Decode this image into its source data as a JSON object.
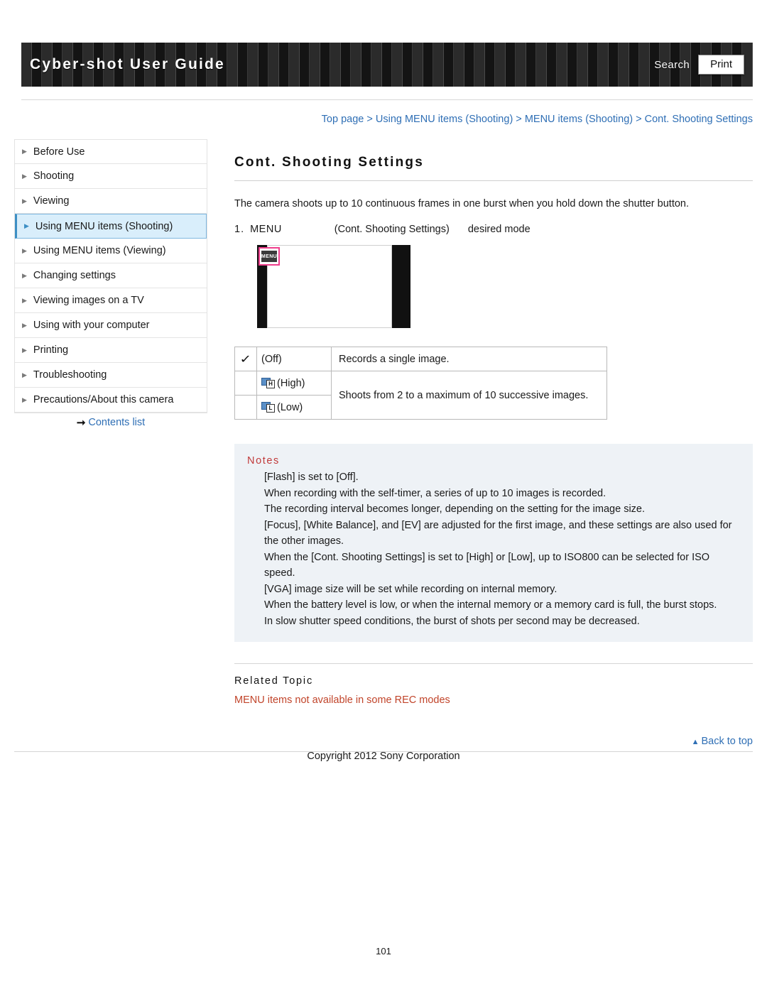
{
  "header": {
    "title": "Cyber-shot User Guide",
    "search_label": "Search",
    "print_label": "Print"
  },
  "breadcrumb": {
    "items": [
      "Top page",
      "Using MENU items (Shooting)",
      "MENU items (Shooting)",
      "Cont. Shooting Settings"
    ],
    "text": "Top page > Using MENU items (Shooting) > MENU items (Shooting) > Cont. Shooting Settings"
  },
  "sidebar": {
    "items": [
      {
        "label": "Before Use",
        "active": false
      },
      {
        "label": "Shooting",
        "active": false
      },
      {
        "label": "Viewing",
        "active": false
      },
      {
        "label": "Using MENU items (Shooting)",
        "active": true
      },
      {
        "label": "Using MENU items (Viewing)",
        "active": false
      },
      {
        "label": "Changing settings",
        "active": false
      },
      {
        "label": "Viewing images on a TV",
        "active": false
      },
      {
        "label": "Using with your computer",
        "active": false
      },
      {
        "label": "Printing",
        "active": false
      },
      {
        "label": "Troubleshooting",
        "active": false
      },
      {
        "label": "Precautions/About this camera",
        "active": false
      }
    ],
    "contents_list_label": "Contents list"
  },
  "main": {
    "title": "Cont. Shooting Settings",
    "intro": "The camera shoots up to 10 continuous frames in one burst when you hold down the shutter button.",
    "step": {
      "number": "1.",
      "menu": "MENU",
      "target": "(Cont. Shooting Settings)",
      "result": "desired mode"
    },
    "illustration": {
      "badge_label": "MENU"
    },
    "table": {
      "rows": [
        {
          "icon": "check-icon",
          "label": "(Off)",
          "desc": "Records a single image."
        },
        {
          "icon": "burst-high-icon",
          "label": "(High)",
          "desc": "Shoots from 2 to a maximum of 10 successive images."
        },
        {
          "icon": "burst-low-icon",
          "label": "(Low)",
          "desc": ""
        }
      ]
    },
    "notes": {
      "title": "Notes",
      "items": [
        "[Flash] is set to [Off].",
        "When recording with the self-timer, a series of up to 10 images is recorded.",
        "The recording interval becomes longer, depending on the setting for the image size.",
        "[Focus], [White Balance], and [EV] are adjusted for the first image, and these settings are also used for the other images.",
        "When the [Cont. Shooting Settings] is set to [High] or [Low], up to ISO800 can be selected for ISO speed.",
        "[VGA] image size will be set while recording on internal memory.",
        "When the battery level is low, or when the internal memory or a memory card is full, the burst stops.",
        "In slow shutter speed conditions, the burst of shots per second may be decreased."
      ]
    },
    "related": {
      "title": "Related Topic",
      "link": "MENU items not available in some REC modes"
    }
  },
  "footer": {
    "back_to_top": "Back to top",
    "copyright": "Copyright 2012 Sony Corporation",
    "page_number": "101"
  }
}
